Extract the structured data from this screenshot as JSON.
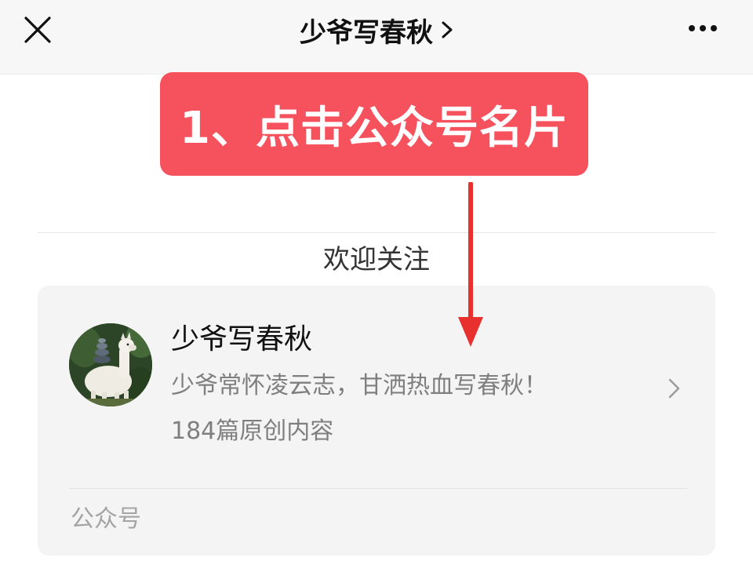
{
  "nav": {
    "title": "少爷写春秋",
    "close_icon": "close-icon",
    "more_icon": "more-horizontal-icon",
    "title_chevron_icon": "chevron-right-icon"
  },
  "annotation": {
    "text": "1、点击公众号名片",
    "color": "#f6525e",
    "arrow_color": "#e8302f"
  },
  "welcome_text": "欢迎关注",
  "account_card": {
    "name": "少爷写春秋",
    "description": "少爷常怀凌云志，甘洒热血写春秋！",
    "article_count": "184篇原创内容",
    "type_label": "公众号",
    "avatar_icon": "alpaca-avatar",
    "chevron_icon": "chevron-right-icon"
  }
}
